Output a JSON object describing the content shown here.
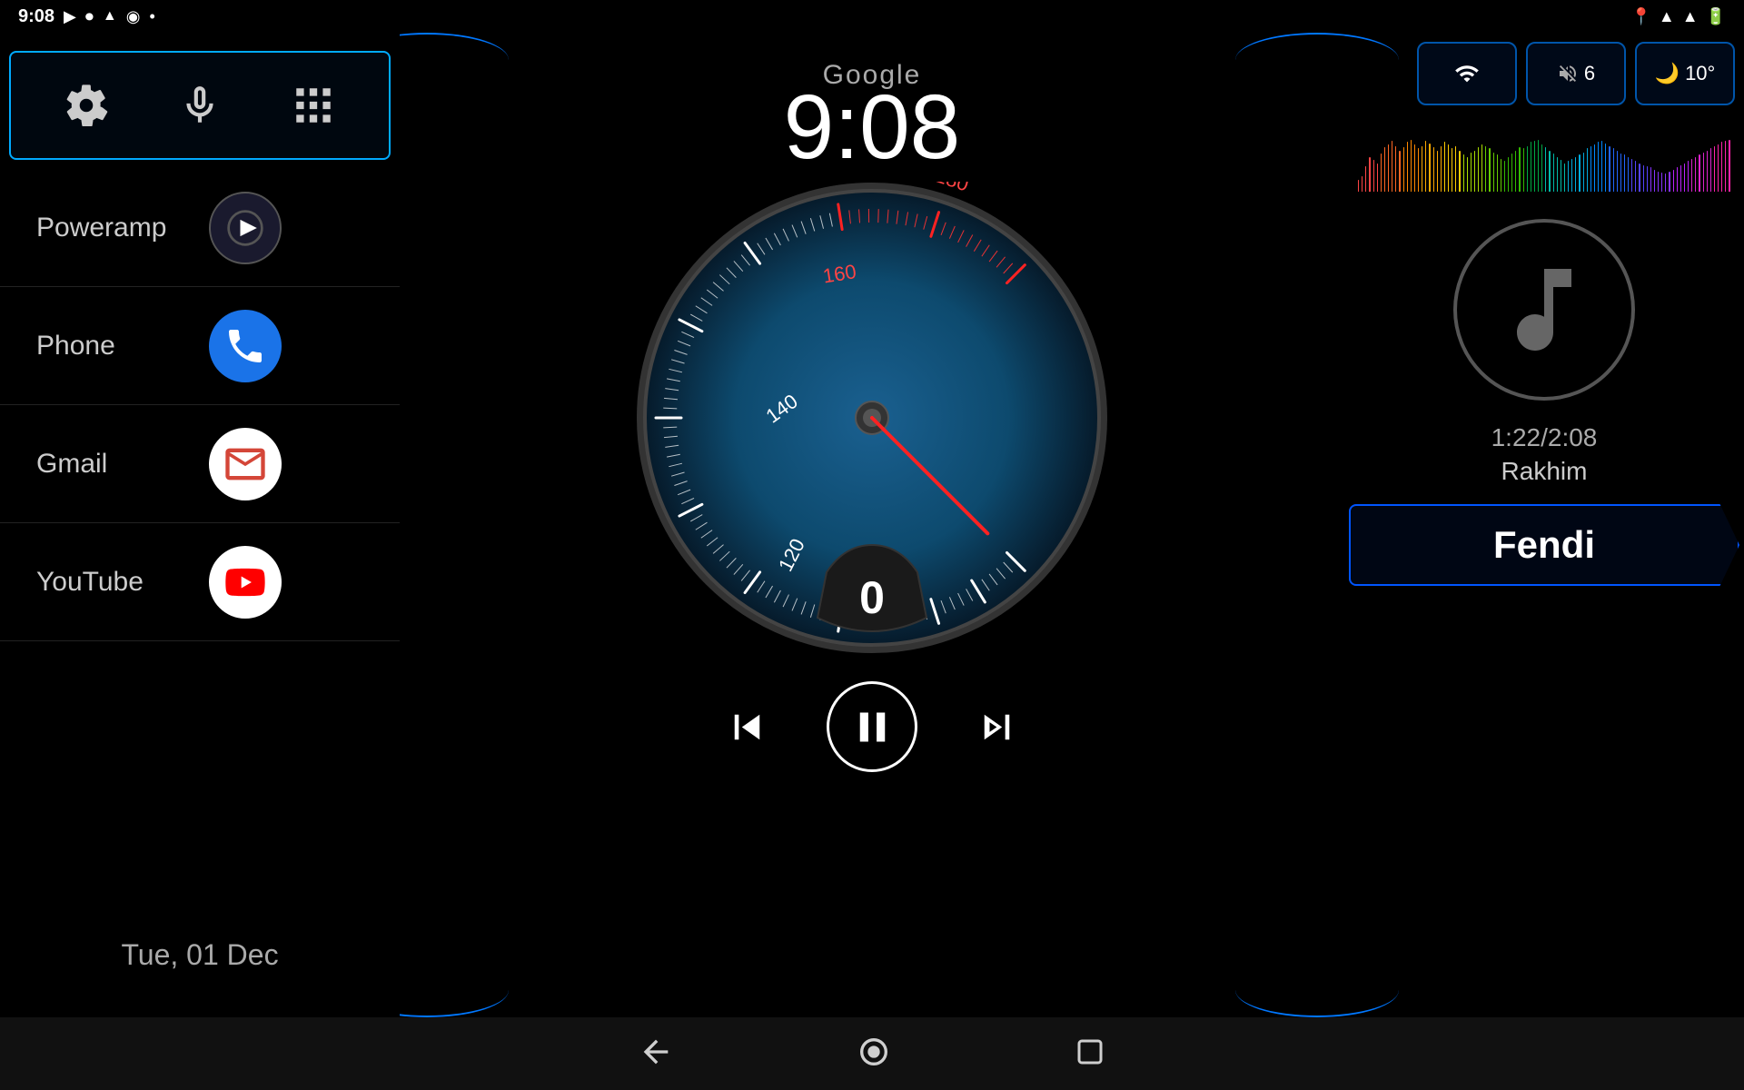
{
  "statusBar": {
    "time": "9:08",
    "leftIcons": [
      "▶",
      "⏺",
      "▲",
      "◉",
      "•"
    ],
    "rightIcons": [
      "📍",
      "▲",
      "▲",
      "🔋"
    ]
  },
  "topControls": {
    "settingsLabel": "settings",
    "micLabel": "microphone",
    "appsLabel": "apps-grid"
  },
  "apps": [
    {
      "name": "Poweramp",
      "iconType": "poweramp"
    },
    {
      "name": "Phone",
      "iconType": "phone"
    },
    {
      "name": "Gmail",
      "iconType": "gmail"
    },
    {
      "name": "YouTube",
      "iconType": "youtube"
    }
  ],
  "date": "Tue, 01 Dec",
  "center": {
    "googleLabel": "Google",
    "time": "9:08",
    "speedValue": "0"
  },
  "rightPanel": {
    "wifi": {
      "label": "wifi",
      "bars": 3
    },
    "volume": {
      "label": "vol",
      "value": "6"
    },
    "weather": {
      "label": "weather",
      "value": "10°"
    },
    "trackTime": "1:22/2:08",
    "artist": "Rakhim",
    "trackTitle": "Fendi"
  },
  "mediaControls": {
    "prevLabel": "previous",
    "pauseLabel": "pause",
    "nextLabel": "next"
  },
  "navBar": {
    "backLabel": "back",
    "homeLabel": "home",
    "recentLabel": "recent"
  },
  "equalizer": {
    "bars": [
      18,
      25,
      40,
      55,
      50,
      45,
      60,
      70,
      75,
      80,
      72,
      65,
      70,
      78,
      82,
      75,
      68,
      72,
      80,
      76,
      70,
      65,
      72,
      78,
      75,
      68,
      72,
      65,
      58,
      55,
      62,
      65,
      70,
      75,
      72,
      68,
      62,
      58,
      52,
      48,
      55,
      60,
      65,
      70,
      68,
      72,
      78,
      80,
      82,
      75,
      70,
      65,
      60,
      55,
      50,
      45,
      48,
      52,
      55,
      58,
      62,
      68,
      72,
      75,
      78,
      80,
      76,
      72,
      68,
      65,
      60,
      58,
      55,
      52,
      48,
      45,
      42,
      40,
      38,
      35,
      32,
      30,
      28,
      32,
      35,
      38,
      42,
      45,
      48,
      52,
      55,
      58,
      62,
      65,
      68,
      72,
      75,
      78,
      80,
      82
    ]
  },
  "eqColors": [
    "#ff4444",
    "#ff6622",
    "#ff8800",
    "#ffaa00",
    "#ffcc00",
    "#aadd00",
    "#66cc00",
    "#33bb00",
    "#00aa44",
    "#00bbaa",
    "#00aadd",
    "#0088ff",
    "#2266ff",
    "#5544ff",
    "#8833ff",
    "#bb22ff",
    "#dd22cc",
    "#ff22aa"
  ]
}
